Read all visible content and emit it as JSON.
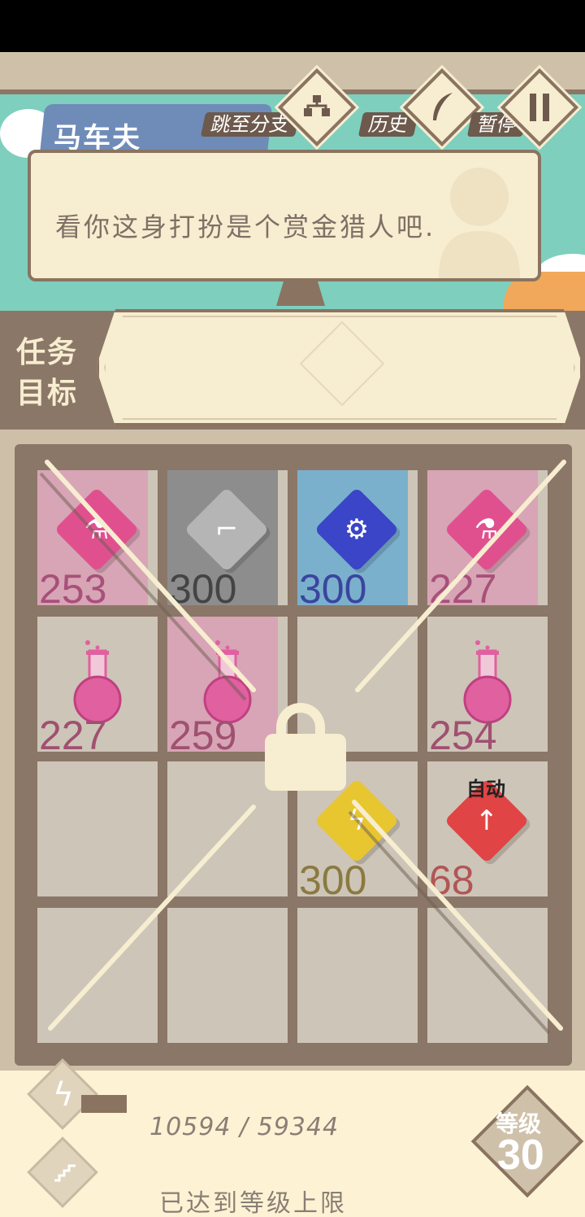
{
  "header": {
    "speaker_name": "马车夫",
    "jump_branch_label": "跳至分支",
    "history_label": "历史",
    "pause_label": "暂停",
    "branch_icon": "branch-tree-icon",
    "history_icon": "feather-icon",
    "pause_icon": "pause-icon"
  },
  "dialog": {
    "text": "看你这身打扮是个赏金猎人吧."
  },
  "quest": {
    "label_line1": "任务",
    "label_line2": "目标"
  },
  "board": {
    "locked": true,
    "auto_label": "自动",
    "cells": [
      {
        "row": 0,
        "col": 0,
        "item": "potion-gem",
        "color": "#e0508f",
        "value": "253",
        "bg": "#d7a5b5"
      },
      {
        "row": 0,
        "col": 1,
        "item": "ladder-gem",
        "color": "#b5b5b5",
        "value": "300",
        "bg": "#8d8d8d"
      },
      {
        "row": 0,
        "col": 2,
        "item": "gear-gem",
        "color": "#3a45c8",
        "value": "300",
        "bg": "#7bb0cc"
      },
      {
        "row": 0,
        "col": 3,
        "item": "potion-gem",
        "color": "#e0508f",
        "value": "227",
        "bg": "#d7a5b5"
      },
      {
        "row": 1,
        "col": 0,
        "item": "flask",
        "color": "#e060a0",
        "value": "227",
        "bg": "#cdc5b8"
      },
      {
        "row": 1,
        "col": 1,
        "item": "flask",
        "color": "#e060a0",
        "value": "259",
        "bg": "#d7a5b5"
      },
      {
        "row": 1,
        "col": 2,
        "item": "empty",
        "value": "",
        "bg": "#cdc5b8"
      },
      {
        "row": 1,
        "col": 3,
        "item": "flask",
        "color": "#e060a0",
        "value": "254",
        "bg": "#cdc5b8"
      },
      {
        "row": 2,
        "col": 0,
        "item": "empty",
        "value": "",
        "bg": "#cdc5b8"
      },
      {
        "row": 2,
        "col": 1,
        "item": "empty",
        "value": "",
        "bg": "#cdc5b8"
      },
      {
        "row": 2,
        "col": 2,
        "item": "lightning-gem",
        "color": "#e8c630",
        "value": "300",
        "bg": "#cdc5b8"
      },
      {
        "row": 2,
        "col": 3,
        "item": "arrow-up-gem",
        "color": "#e04444",
        "value": "68",
        "bg": "#cdc5b8"
      },
      {
        "row": 3,
        "col": 0,
        "item": "empty",
        "value": "",
        "bg": "#cdc5b8"
      },
      {
        "row": 3,
        "col": 1,
        "item": "empty",
        "value": "",
        "bg": "#cdc5b8"
      },
      {
        "row": 3,
        "col": 2,
        "item": "empty",
        "value": "",
        "bg": "#cdc5b8"
      },
      {
        "row": 3,
        "col": 3,
        "item": "empty",
        "value": "",
        "bg": "#cdc5b8"
      }
    ]
  },
  "status": {
    "xp_text": "10594 / 59344",
    "xp_fraction": 0.178,
    "max_level_text": "已达到等级上限",
    "level_label": "等级",
    "level_value": "30",
    "skill_icon_1": "lightning-icon",
    "skill_icon_2": "ladder-icon"
  }
}
